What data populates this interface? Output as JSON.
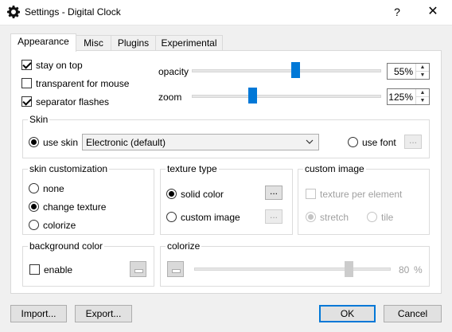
{
  "window": {
    "title": "Settings - Digital Clock",
    "help_label": "?",
    "close_label": "✕",
    "icon": "gear-icon"
  },
  "tabs": [
    {
      "label": "Appearance",
      "active": true
    },
    {
      "label": "Misc",
      "active": false
    },
    {
      "label": "Plugins",
      "active": false
    },
    {
      "label": "Experimental",
      "active": false
    }
  ],
  "options": {
    "stay_on_top": {
      "label": "stay on top",
      "checked": true
    },
    "transparent_for_mouse": {
      "label": "transparent for mouse",
      "checked": false
    },
    "separator_flashes": {
      "label": "separator flashes",
      "checked": true
    }
  },
  "opacity": {
    "label": "opacity",
    "value": 55,
    "display": "55%"
  },
  "zoom": {
    "label": "zoom",
    "value": 125,
    "display": "125%"
  },
  "skin": {
    "title": "Skin",
    "use_skin_label": "use skin",
    "use_skin_selected": true,
    "selected_skin": "Electronic (default)",
    "use_font_label": "use font",
    "use_font_selected": false,
    "font_button_label": "..."
  },
  "skin_customization": {
    "title": "skin customization",
    "options": [
      {
        "label": "none",
        "selected": false
      },
      {
        "label": "change texture",
        "selected": true
      },
      {
        "label": "colorize",
        "selected": false
      }
    ]
  },
  "texture_type": {
    "title": "texture type",
    "solid_color_label": "solid color",
    "solid_color_selected": true,
    "custom_image_label": "custom image",
    "custom_image_selected": false,
    "solid_button_label": "...",
    "image_button_label": "..."
  },
  "custom_image": {
    "title": "custom image",
    "texture_per_element_label": "texture per element",
    "stretch_label": "stretch",
    "stretch_selected": true,
    "tile_label": "tile"
  },
  "background_color": {
    "title": "background color",
    "enable_label": "enable",
    "enabled": false
  },
  "colorize": {
    "title": "colorize",
    "value": 80,
    "display": "80",
    "unit": "%"
  },
  "footer": {
    "import_label": "Import...",
    "export_label": "Export...",
    "ok_label": "OK",
    "cancel_label": "Cancel"
  },
  "colors": {
    "accent": "#0078d7",
    "disabled": "#a0a0a0"
  }
}
